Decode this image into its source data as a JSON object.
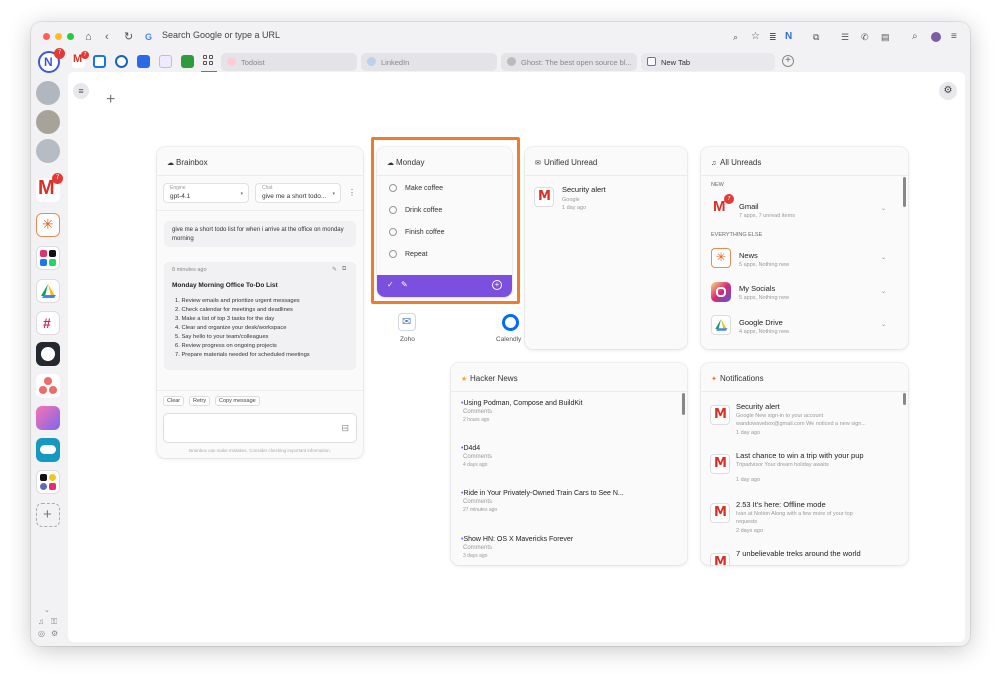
{
  "browser": {
    "url_placeholder": "Search Google or type a URL",
    "tabs": [
      {
        "label": "Todoist"
      },
      {
        "label": "LinkedIn"
      },
      {
        "label": "Ghost: The best open source bl..."
      },
      {
        "label": "New Tab"
      }
    ],
    "account_badge": "7",
    "gmail_badge": "7"
  },
  "sidebar": {
    "gmail_badge": "7"
  },
  "brainbox": {
    "title": "Brainbox",
    "engine_label": "Engine",
    "engine_value": "gpt-4.1",
    "chat_label": "Chat",
    "chat_value": "give me a short todo...",
    "prompt": "give me a short todo list for when i arrive at the office on monday morning",
    "time": "8 minutes ago",
    "response_title": "Monday Morning Office To-Do List",
    "response_items": [
      "1. Review emails and prioritize urgent messages",
      "2. Check calendar for meetings and deadlines",
      "3. Make a list of top 3 tasks for the day",
      "4. Clear and organize your desk/workspace",
      "5. Say hello to your team/colleagues",
      "6. Review progress on ongoing projects",
      "7. Prepare materials needed for scheduled meetings"
    ],
    "btn_clear": "Clear",
    "btn_retry": "Retry",
    "btn_copy": "Copy message",
    "disclaimer": "Brainbox can make mistakes. Consider checking important information."
  },
  "monday": {
    "title": "Monday",
    "items": [
      "Make coffee",
      "Drink coffee",
      "Finish coffee",
      "Repeat"
    ],
    "highlight_color": "#f07b2b"
  },
  "apps": [
    {
      "label": "Zoho"
    },
    {
      "label": "Calendly"
    }
  ],
  "unified": {
    "title": "Unified Unread",
    "item_title": "Security alert",
    "item_source": "Google",
    "item_time": "1 day ago"
  },
  "allunreads": {
    "title": "All Unreads",
    "section_new": "NEW",
    "gmail_title": "Gmail",
    "gmail_badge": "7",
    "gmail_sub": "7 apps, 7 unread items",
    "section_else": "EVERYTHING ELSE",
    "items": [
      {
        "title": "News",
        "sub": "5 apps, Nothing new"
      },
      {
        "title": "My Socials",
        "sub": "5 apps, Nothing new"
      },
      {
        "title": "Google Drive",
        "sub": "4 apps, Nothing new"
      }
    ]
  },
  "hackernews": {
    "title": "Hacker News",
    "items": [
      {
        "title": "Using Podman, Compose and BuildKit",
        "comments": "Comments",
        "time": "2 hours ago"
      },
      {
        "title": "D4d4",
        "comments": "Comments",
        "time": "4 days ago"
      },
      {
        "title": "Ride in Your Privately-Owned Train Cars to See N...",
        "comments": "Comments",
        "time": "27 minutes ago"
      },
      {
        "title": "Show HN: OS X Mavericks Forever",
        "comments": "Comments",
        "time": "3 days ago"
      }
    ]
  },
  "notifications": {
    "title": "Notifications",
    "items": [
      {
        "title": "Security alert",
        "body1": "Google New sign-in to your account",
        "body2": "wandowavebox@gmail.com We noticed a new sign...",
        "time": "1 day ago"
      },
      {
        "title": "Last chance to win a trip with your pup",
        "body1": "Tripadvisor Your dream holiday awaits",
        "body2": "",
        "time": "1 day ago"
      },
      {
        "title": "2.53 It's here: Offline mode",
        "body1": "Ivan at Notion Along with a few more of your top",
        "body2": "requests",
        "time": "2 days ago"
      },
      {
        "title": "7 unbelievable treks around the world",
        "body1": "",
        "body2": "",
        "time": ""
      }
    ]
  }
}
